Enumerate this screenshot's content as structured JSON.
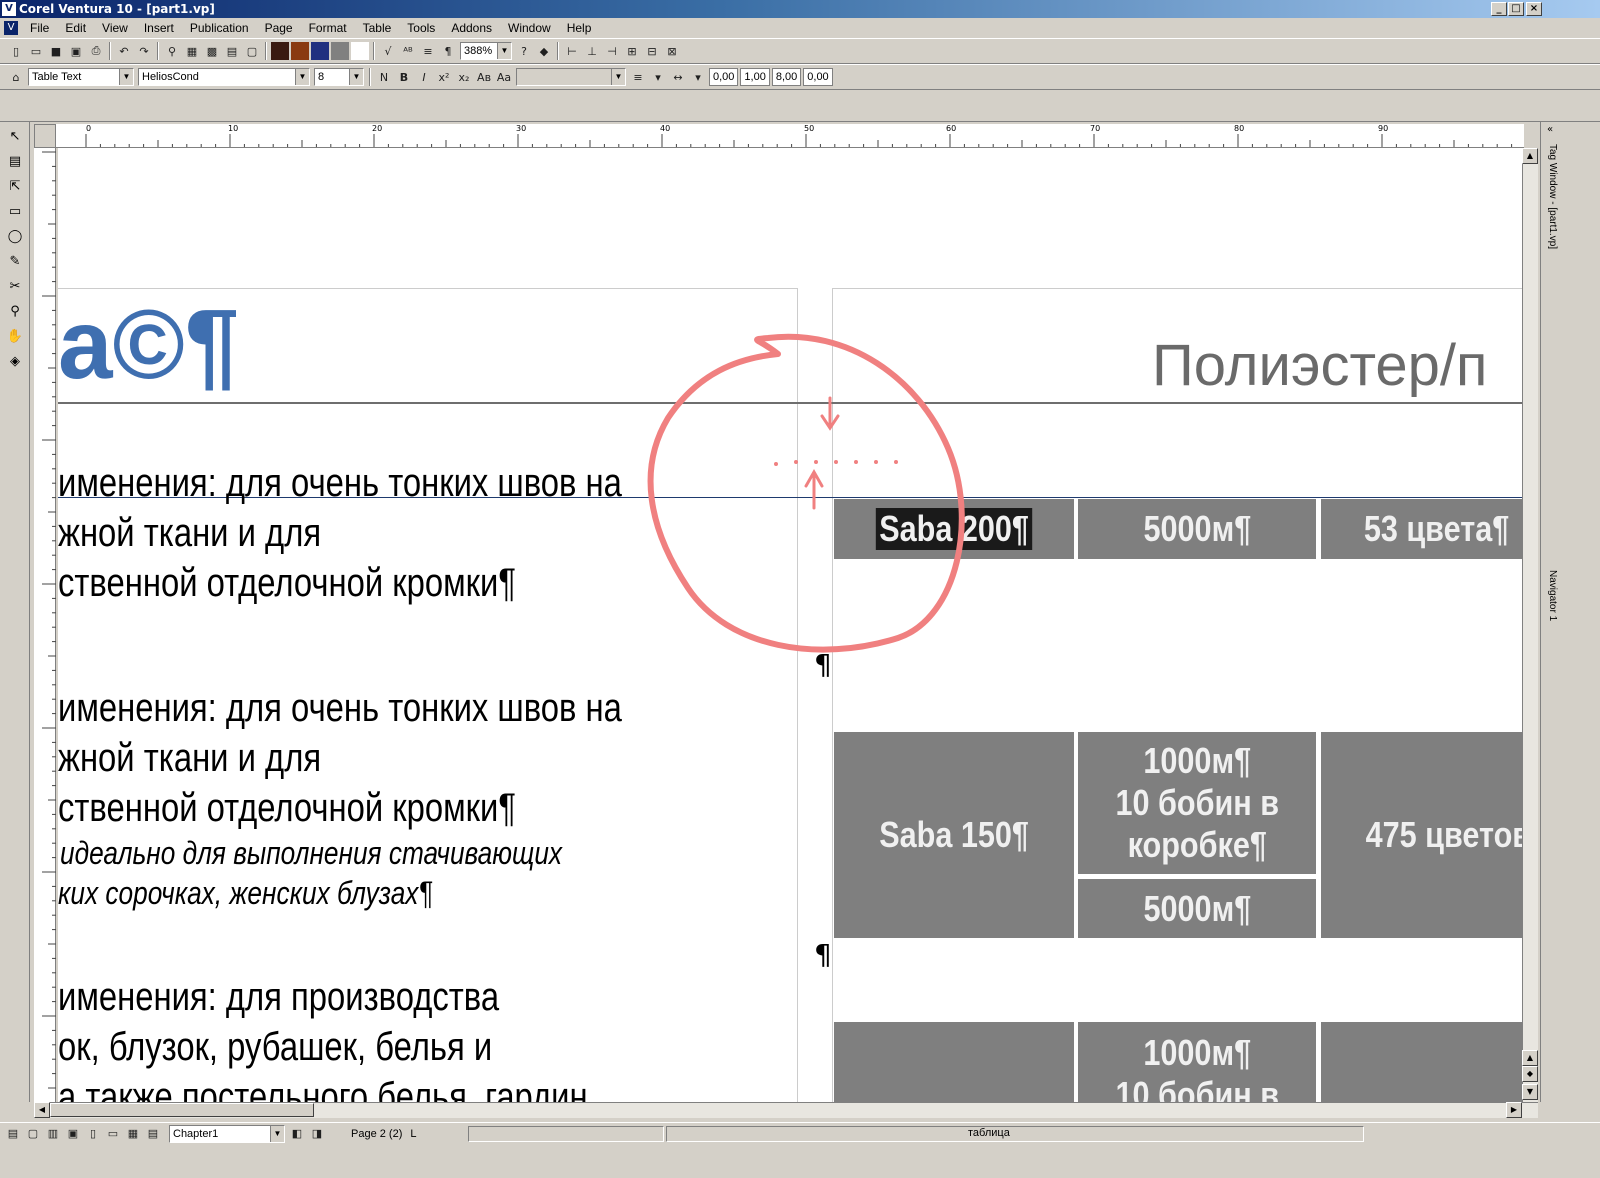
{
  "window": {
    "title": "Corel Ventura 10 - [part1.vp]",
    "app_icon": "V"
  },
  "menu": [
    "File",
    "Edit",
    "View",
    "Insert",
    "Publication",
    "Page",
    "Format",
    "Table",
    "Tools",
    "Addons",
    "Window",
    "Help"
  ],
  "toolbar": {
    "zoom": "388%",
    "tag": "Table Text",
    "font": "HeliosCond",
    "size": "8",
    "tab_values": [
      "0,00",
      "1,00",
      "8,00",
      "0,00"
    ],
    "color_swatches": [
      "#3a1a10",
      "#8a3a10",
      "#203080",
      "#808080",
      "#ffffff"
    ]
  },
  "ruler": {
    "labels": [
      "0",
      "10",
      "20",
      "30",
      "40",
      "50",
      "60",
      "70",
      "80",
      "90"
    ]
  },
  "document": {
    "logo_text": "a©¶",
    "heading": "Полиэстер/п",
    "left_column": [
      {
        "lines": [
          "именения: для очень тонких швов на",
          "жной ткани и для",
          "ственной отделочной кромки¶"
        ]
      },
      {
        "lines": [
          "именения: для очень тонких швов на",
          "жной ткани и для",
          "ственной отделочной кромки¶"
        ],
        "italic": [
          "идеально для выполнения стачивающих",
          "ких сорочках, женских блузах¶"
        ]
      },
      {
        "lines": [
          "именения: для производства",
          "ок, блузок, рубашек, белья и",
          "а также постельного белья, гардин"
        ]
      }
    ],
    "pilcrow": "¶",
    "table_rows": [
      {
        "name": "Saba 200¶",
        "length": "5000м¶",
        "colors": "53 цвета¶"
      },
      {
        "name": "Saba 150¶",
        "length_a": "1000м¶\n10 бобин в\nкоробке¶",
        "length_b": "5000м¶",
        "colors": "475 цветов"
      },
      {
        "name": "",
        "length": "1000м¶\n10 бобин в",
        "colors": ""
      }
    ]
  },
  "right_panel": {
    "tab1": "Tag Window - [part1.vp]",
    "tab2": "Navigator 1"
  },
  "status": {
    "chapter": "Chapter1",
    "page": "Page 2 (2)",
    "side": "L",
    "tag": "таблица"
  }
}
